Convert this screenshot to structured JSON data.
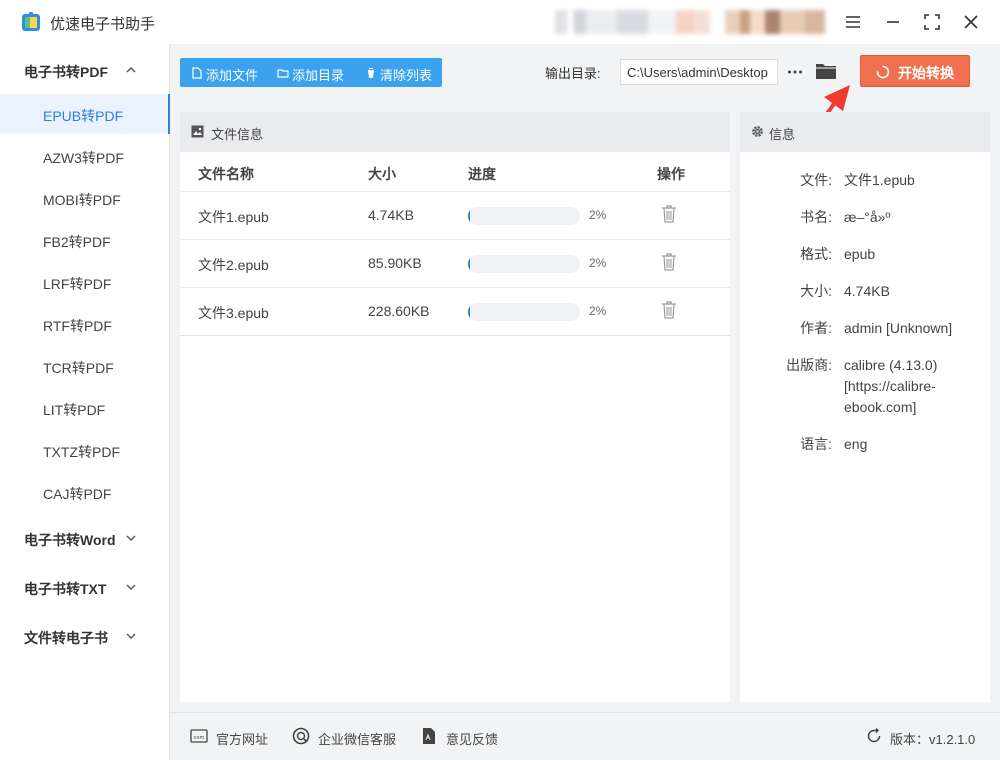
{
  "app": {
    "title": "优速电子书助手"
  },
  "sidebar": {
    "categories": [
      {
        "label": "电子书转PDF",
        "expanded": true
      },
      {
        "label": "电子书转Word",
        "expanded": false
      },
      {
        "label": "电子书转TXT",
        "expanded": false
      },
      {
        "label": "文件转电子书",
        "expanded": false
      }
    ],
    "pdf_items": [
      "EPUB转PDF",
      "AZW3转PDF",
      "MOBI转PDF",
      "FB2转PDF",
      "LRF转PDF",
      "RTF转PDF",
      "TCR转PDF",
      "LIT转PDF",
      "TXTZ转PDF",
      "CAJ转PDF"
    ],
    "active_item": "EPUB转PDF"
  },
  "toolbar": {
    "add_file": "添加文件",
    "add_folder": "添加目录",
    "clear_list": "清除列表",
    "output_label": "输出目录:",
    "output_path": "C:\\Users\\admin\\Desktop",
    "start": "开始转换"
  },
  "file_panel": {
    "title": "文件信息",
    "columns": [
      "文件名称",
      "大小",
      "进度",
      "操作"
    ],
    "rows": [
      {
        "name": "文件1.epub",
        "size": "4.74KB",
        "progress": 2,
        "progress_text": "2%"
      },
      {
        "name": "文件2.epub",
        "size": "85.90KB",
        "progress": 2,
        "progress_text": "2%"
      },
      {
        "name": "文件3.epub",
        "size": "228.60KB",
        "progress": 2,
        "progress_text": "2%"
      }
    ]
  },
  "info_panel": {
    "title": "信息",
    "fields": [
      {
        "key": "文件:",
        "value": "文件1.epub"
      },
      {
        "key": "书名:",
        "value": "æ–°å»º"
      },
      {
        "key": "格式:",
        "value": "epub"
      },
      {
        "key": "大小:",
        "value": "4.74KB"
      },
      {
        "key": "作者:",
        "value": "admin [Unknown]"
      },
      {
        "key": "出版商:",
        "value": "calibre (4.13.0) [https://calibre-ebook.com]"
      },
      {
        "key": "语言:",
        "value": "eng"
      }
    ]
  },
  "footer": {
    "website": "官方网址",
    "wechat": "企业微信客服",
    "feedback": "意见反馈",
    "version": "版本：v1.2.1.0"
  },
  "colors": {
    "accent": "#2b7fe0",
    "toolbar": "#3aa2ef",
    "start": "#f0714f",
    "arrow": "#ee3b2f"
  }
}
